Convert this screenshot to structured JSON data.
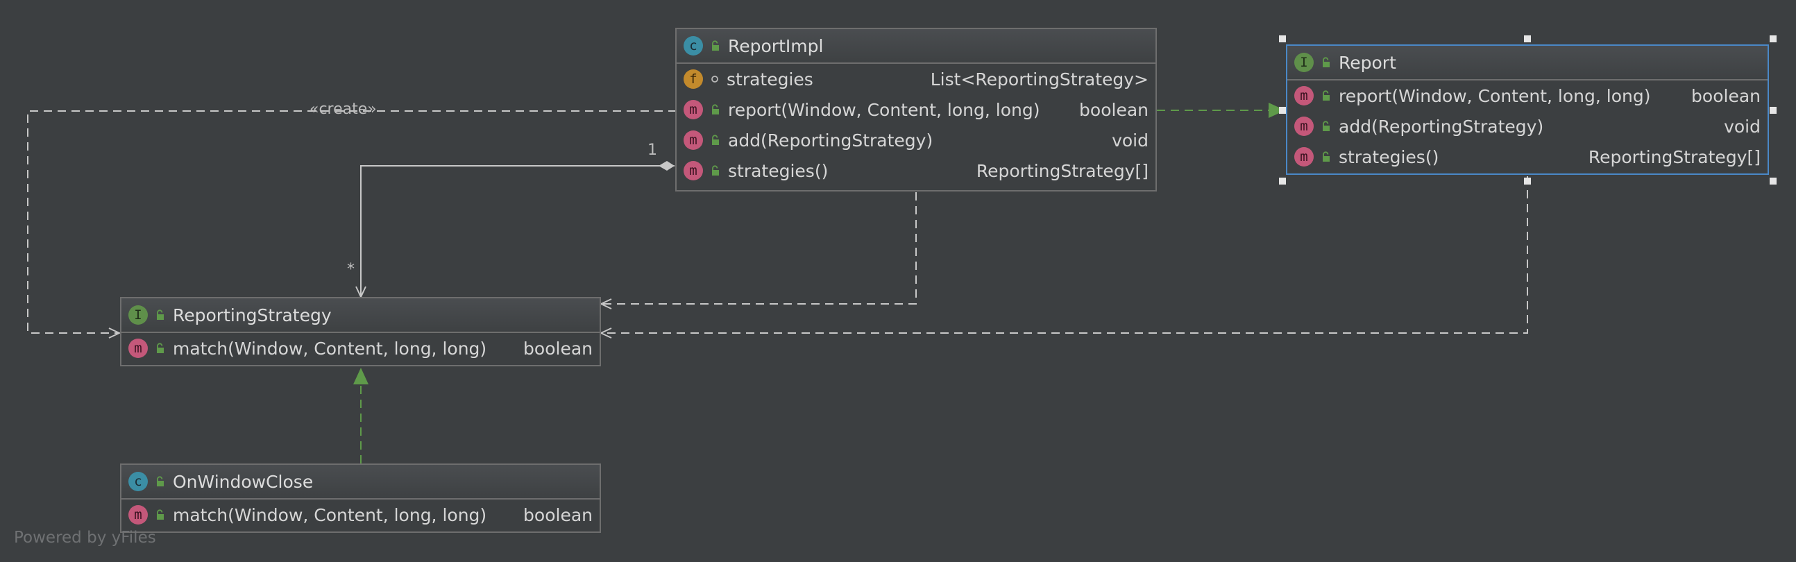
{
  "nodes": {
    "report_impl": {
      "badge": "c",
      "title": "ReportImpl",
      "members": [
        {
          "badge": "f",
          "name": "strategies",
          "type": "List<ReportingStrategy>"
        },
        {
          "badge": "m",
          "name": "report(Window, Content, long, long)",
          "type": "boolean"
        },
        {
          "badge": "m",
          "name": "add(ReportingStrategy)",
          "type": "void"
        },
        {
          "badge": "m",
          "name": "strategies()",
          "type": "ReportingStrategy[]"
        }
      ]
    },
    "report": {
      "badge": "I",
      "title": "Report",
      "members": [
        {
          "badge": "m",
          "name": "report(Window, Content, long, long)",
          "type": "boolean"
        },
        {
          "badge": "m",
          "name": "add(ReportingStrategy)",
          "type": "void"
        },
        {
          "badge": "m",
          "name": "strategies()",
          "type": "ReportingStrategy[]"
        }
      ]
    },
    "reporting_strategy": {
      "badge": "I",
      "title": "ReportingStrategy",
      "members": [
        {
          "badge": "m",
          "name": "match(Window, Content, long, long)",
          "type": "boolean"
        }
      ]
    },
    "on_window_close": {
      "badge": "c",
      "title": "OnWindowClose",
      "members": [
        {
          "badge": "m",
          "name": "match(Window, Content, long, long)",
          "type": "boolean"
        }
      ]
    }
  },
  "edges": {
    "create_label": "«create»",
    "multiplicity_one": "1",
    "multiplicity_many": "*"
  },
  "colors": {
    "background": "#3c3f41",
    "edge_gray": "#c8c8c8",
    "edge_green": "#5f9a4a",
    "selection_blue": "#4a88c7"
  },
  "footer": "Powered by yFiles"
}
